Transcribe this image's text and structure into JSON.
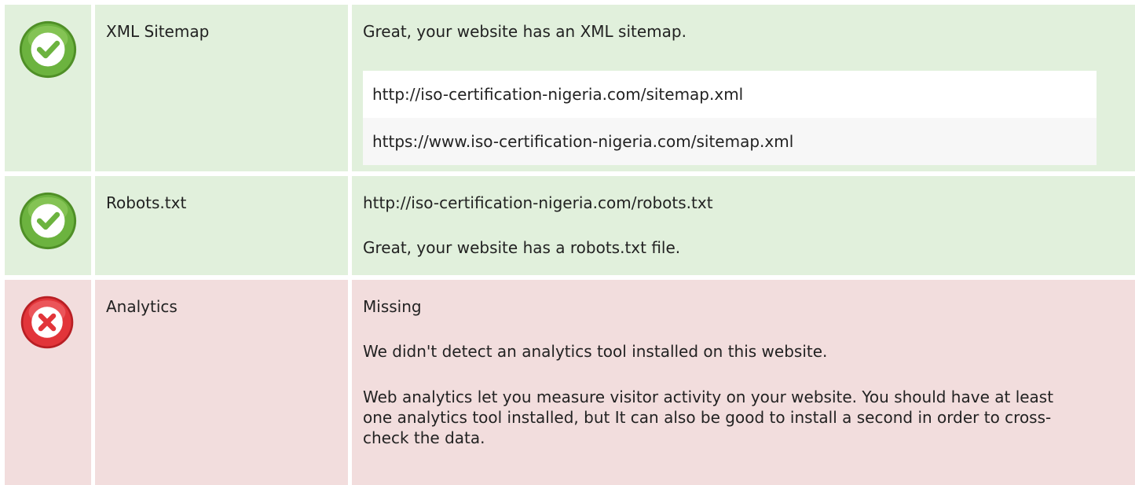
{
  "checks": [
    {
      "status": "pass",
      "icon": "check-circle-icon",
      "name": "XML Sitemap",
      "message": "Great, your website has an XML sitemap.",
      "urls": [
        "http://iso-certification-nigeria.com/sitemap.xml",
        "https://www.iso-certification-nigeria.com/sitemap.xml"
      ]
    },
    {
      "status": "pass",
      "icon": "check-circle-icon",
      "name": "Robots.txt",
      "url": "http://iso-certification-nigeria.com/robots.txt",
      "message": "Great, your website has a robots.txt file."
    },
    {
      "status": "fail",
      "icon": "error-circle-icon",
      "name": "Analytics",
      "value": "Missing",
      "message": "We didn't detect an analytics tool installed on this website.",
      "details": "Web analytics let you measure visitor activity on your website. You should have at least one analytics tool installed, but It can also be good to install a second in order to cross-check the data."
    }
  ],
  "colors": {
    "pass_bg": "#e1f0dc",
    "fail_bg": "#f2dddd",
    "pass_icon": "#6cb33f",
    "fail_icon": "#e2353a"
  }
}
